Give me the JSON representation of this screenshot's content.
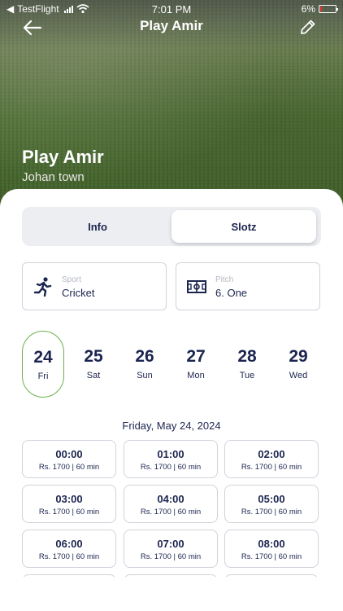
{
  "status_bar": {
    "carrier": "TestFlight",
    "time": "7:01 PM",
    "battery": "6%"
  },
  "header": {
    "title": "Play Amir"
  },
  "venue": {
    "name": "Play Amir",
    "location": "Johan town"
  },
  "tabs": [
    {
      "label": "Info",
      "active": false
    },
    {
      "label": "Slotz",
      "active": true
    }
  ],
  "sport": {
    "label": "Sport",
    "value": "Cricket"
  },
  "pitch": {
    "label": "Pitch",
    "value": "6. One"
  },
  "dates": [
    {
      "num": "24",
      "day": "Fri",
      "selected": true
    },
    {
      "num": "25",
      "day": "Sat"
    },
    {
      "num": "26",
      "day": "Sun"
    },
    {
      "num": "27",
      "day": "Mon"
    },
    {
      "num": "28",
      "day": "Tue"
    },
    {
      "num": "29",
      "day": "Wed"
    }
  ],
  "selected_date_heading": "Friday, May 24, 2024",
  "slots": [
    {
      "time": "00:00",
      "price": "Rs. 1700 | 60 min"
    },
    {
      "time": "01:00",
      "price": "Rs. 1700 | 60 min"
    },
    {
      "time": "02:00",
      "price": "Rs. 1700 | 60 min"
    },
    {
      "time": "03:00",
      "price": "Rs. 1700 | 60 min"
    },
    {
      "time": "04:00",
      "price": "Rs. 1700 | 60 min"
    },
    {
      "time": "05:00",
      "price": "Rs. 1700 | 60 min"
    },
    {
      "time": "06:00",
      "price": "Rs. 1700 | 60 min"
    },
    {
      "time": "07:00",
      "price": "Rs. 1700 | 60 min"
    },
    {
      "time": "08:00",
      "price": "Rs. 1700 | 60 min"
    }
  ],
  "colors": {
    "primary_text": "#1c2550",
    "selected_date_border": "#6ab04c",
    "tab_bg": "#eceef1"
  }
}
